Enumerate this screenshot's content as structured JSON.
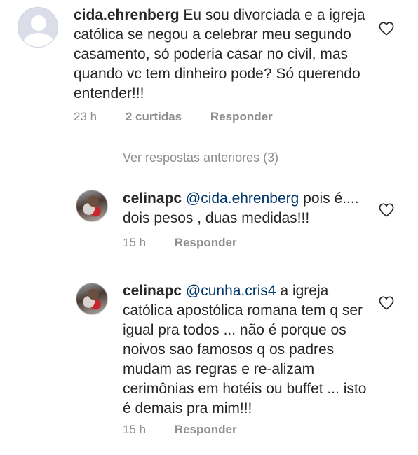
{
  "comments": [
    {
      "username": "cida.ehrenberg",
      "mention": "",
      "text": "Eu sou divorciada e a igreja católica se negou a celebrar meu segundo casamento, só poderia casar no civil, mas quando vc tem dinheiro pode? Só querendo entender!!!",
      "time": "23 h",
      "likes": "2 curtidas",
      "reply_label": "Responder",
      "avatar_icon": "default-user-icon"
    },
    {
      "username": "celinapc",
      "mention": "@cida.ehrenberg",
      "text": "pois é.... dois pesos , duas medidas!!!",
      "time": "15 h",
      "likes": "",
      "reply_label": "Responder",
      "avatar_icon": "profile-photo"
    },
    {
      "username": "celinapc",
      "mention": "@cunha.cris4",
      "text": "a igreja católica apostólica romana tem q ser igual pra todos ... não é porque os noivos sao famosos q os padres mudam as regras e re-alizam cerimônias em hotéis ou buffet ... isto é demais pra mim!!!",
      "time": "15 h",
      "likes": "",
      "reply_label": "Responder",
      "avatar_icon": "profile-photo"
    }
  ],
  "view_replies_label": "Ver respostas anteriores (3)",
  "colors": {
    "text": "#262626",
    "secondary": "#8e8e8e",
    "mention": "#00376b"
  }
}
